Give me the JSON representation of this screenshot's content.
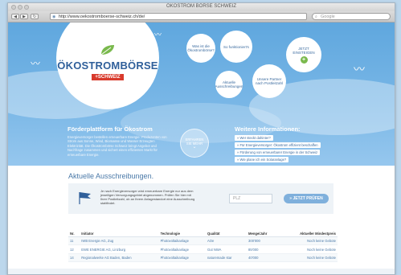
{
  "browser": {
    "window_title": "ÖKOSTROM BÖRSE SCHWEIZ",
    "url": "http://www.oekostromboerse-schweiz.ch/de/",
    "search_placeholder": "Google",
    "back_icon": "back-arrow-icon",
    "forward_icon": "forward-arrow-icon"
  },
  "hero": {
    "logo_text": "ÖKOSTROMBÖRSE",
    "logo_badge": "+SCHWEIZ",
    "bubbles": [
      {
        "label": "Was ist die Ökostrombörse?"
      },
      {
        "label": "So funktioniert's"
      },
      {
        "label": "JETZT EINSTEIGEN"
      },
      {
        "label": "Aktuelle Ausschreibungen"
      },
      {
        "label": "Unsere Partner nach Postleitzahl"
      }
    ],
    "left_title": "Förderplattform für Ökostrom",
    "left_body": "Energieversorger bestellen erneuerbare Energie: Produzenten von Strom aus Sonne, Wind, Biomasse und Wasser Erzeugten Elektrizität. Die Ökostrombörse Schweiz bringt Angebot und Nachfrage zusammen und sichert einen effizienten Markt für erneuerbare Energie.",
    "learn_more": "ERFAHREN SIE MEHR",
    "right_title": "Weitere Informationen:",
    "info_links": [
      "» Wer steckt dahinter?",
      "» Für Energieversorger: Ökostrom effizient beschaffen",
      "» Förderung von erneuerbarer Energie in der Schweiz",
      "» Wie plane ich ein Solaranlage?"
    ]
  },
  "tenders": {
    "title": "Aktuelle Ausschreibungen.",
    "intro": "Je nach Energieversorger wird erneuerbare Energie nur aus dem jeweiligen Versorgungsgebiet abgenommen. Prüfen Sie hier mit Ihrer Postleitzahl, ob an Ihrem Anlagestandort eine Ausschreibung stattfindet.",
    "plz_placeholder": "PLZ",
    "button_label": "» JETZT PRÜFEN",
    "columns": [
      "Nr.",
      "Initiator",
      "Technologie",
      "Qualität",
      "Menge/Jahr",
      "Aktueller Mindestpreis"
    ],
    "rows": [
      [
        "11",
        "IWB Energie AG, Zug",
        "Photovoltaikanlage",
        "AOe",
        "300'000",
        "Noch keine Gebote"
      ],
      [
        "12",
        "EWE ENERGIE AG, Linzburg",
        "Photovoltaikanlage",
        "Gut NWA",
        "85'000",
        "Noch keine Gebote"
      ],
      [
        "14",
        "Regionalwerke AG Baden, Baden",
        "Photovoltaikanlage",
        "naturemade star",
        "40'000",
        "Noch keine Gebote"
      ]
    ]
  },
  "colors": {
    "hero_blue": "#6aaee2",
    "accent_red": "#d83a2c",
    "accent_green": "#7ab94d",
    "link_blue": "#4a79a8"
  }
}
